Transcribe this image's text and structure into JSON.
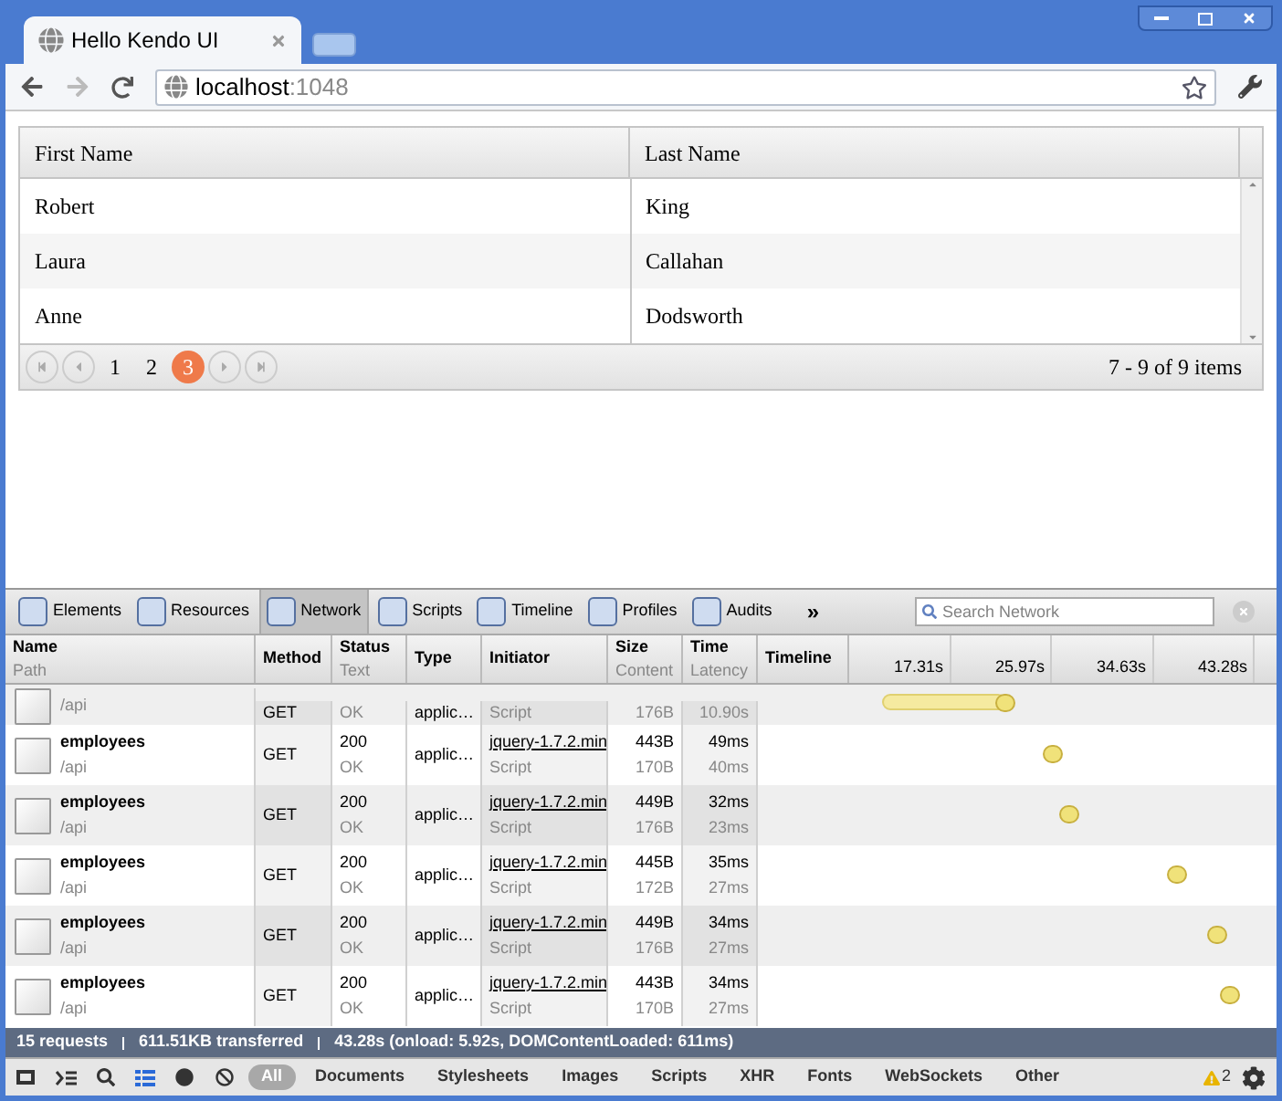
{
  "browser": {
    "tab_title": "Hello Kendo UI",
    "url_host": "localhost",
    "url_port": ":1048"
  },
  "grid": {
    "columns": [
      "First Name",
      "Last Name"
    ],
    "rows": [
      {
        "first": "Robert",
        "last": "King"
      },
      {
        "first": "Laura",
        "last": "Callahan"
      },
      {
        "first": "Anne",
        "last": "Dodsworth"
      }
    ],
    "pages": [
      {
        "label": "1",
        "selected": false
      },
      {
        "label": "2",
        "selected": false
      },
      {
        "label": "3",
        "selected": true
      }
    ],
    "summary": "7 - 9 of 9 items"
  },
  "devtools": {
    "tabs": [
      {
        "label": "Elements",
        "selected": false
      },
      {
        "label": "Resources",
        "selected": false
      },
      {
        "label": "Network",
        "selected": true
      },
      {
        "label": "Scripts",
        "selected": false
      },
      {
        "label": "Timeline",
        "selected": false
      },
      {
        "label": "Profiles",
        "selected": false
      },
      {
        "label": "Audits",
        "selected": false
      }
    ],
    "more": "»",
    "search_placeholder": "Search Network",
    "columns": [
      {
        "title": "Name",
        "sub": "Path"
      },
      {
        "title": "Method"
      },
      {
        "title": "Status",
        "sub": "Text"
      },
      {
        "title": "Type"
      },
      {
        "title": "Initiator"
      },
      {
        "title": "Size",
        "sub": "Content"
      },
      {
        "title": "Time",
        "sub": "Latency"
      },
      {
        "title": "Timeline"
      }
    ],
    "ticks": [
      "17.31s",
      "25.97s",
      "34.63s",
      "43.28s"
    ],
    "requests": [
      {
        "path": "/api",
        "method": "GET",
        "status_text": "OK",
        "type": "applic…",
        "initiator_type": "Script",
        "content": "176B",
        "latency": "10.90s"
      },
      {
        "name": "employees",
        "path": "/api",
        "method": "GET",
        "status": "200",
        "status_text": "OK",
        "type": "applic…",
        "initiator": "jquery-1.7.2.min",
        "initiator_type": "Script",
        "size": "443B",
        "content": "170B",
        "time": "49ms",
        "latency": "40ms"
      },
      {
        "name": "employees",
        "path": "/api",
        "method": "GET",
        "status": "200",
        "status_text": "OK",
        "type": "applic…",
        "initiator": "jquery-1.7.2.min",
        "initiator_type": "Script",
        "size": "449B",
        "content": "176B",
        "time": "32ms",
        "latency": "23ms"
      },
      {
        "name": "employees",
        "path": "/api",
        "method": "GET",
        "status": "200",
        "status_text": "OK",
        "type": "applic…",
        "initiator": "jquery-1.7.2.min",
        "initiator_type": "Script",
        "size": "445B",
        "content": "172B",
        "time": "35ms",
        "latency": "27ms"
      },
      {
        "name": "employees",
        "path": "/api",
        "method": "GET",
        "status": "200",
        "status_text": "OK",
        "type": "applic…",
        "initiator": "jquery-1.7.2.min",
        "initiator_type": "Script",
        "size": "449B",
        "content": "176B",
        "time": "34ms",
        "latency": "27ms"
      },
      {
        "name": "employees",
        "path": "/api",
        "method": "GET",
        "status": "200",
        "status_text": "OK",
        "type": "applic…",
        "initiator": "jquery-1.7.2.min",
        "initiator_type": "Script",
        "size": "443B",
        "content": "170B",
        "time": "34ms",
        "latency": "27ms"
      }
    ],
    "summary": [
      "15 requests",
      "611.51KB transferred",
      "43.28s (onload: 5.92s, DOMContentLoaded: 611ms)"
    ],
    "filters": [
      {
        "label": "All",
        "selected": true
      },
      {
        "label": "Documents",
        "selected": false
      },
      {
        "label": "Stylesheets",
        "selected": false
      },
      {
        "label": "Images",
        "selected": false
      },
      {
        "label": "Scripts",
        "selected": false
      },
      {
        "label": "XHR",
        "selected": false
      },
      {
        "label": "Fonts",
        "selected": false
      },
      {
        "label": "WebSockets",
        "selected": false
      },
      {
        "label": "Other",
        "selected": false
      }
    ],
    "warnings": "2"
  }
}
